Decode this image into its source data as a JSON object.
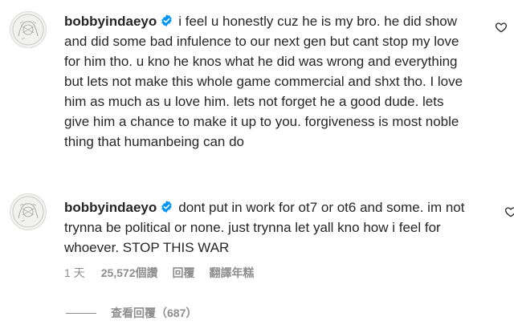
{
  "comments": [
    {
      "username": "bobbyindaeyo",
      "text": "i feel u honestly cuz he is my bro. he did show and did some bad infulence to our next gen but cant stop my love for him tho. u kno he knos what he did was wrong and everything but lets not make this whole game commercial and shxt tho. I love him as much as u love him. lets not forget he a good dude. lets give him a chance to make it up to you. forgiveness is most noble thing that humanbeing can do"
    },
    {
      "username": "bobbyindaeyo",
      "text": "dont put in work for ot7 or ot6 and some. im not trynna be political or none. just trynna let yall kno how i feel for whoever. STOP THIS WAR",
      "meta": {
        "time": "1 天",
        "likes": "25,572個讚",
        "reply": "回覆",
        "translate": "翻譯年糕"
      },
      "view_replies": "查看回覆（687）"
    }
  ],
  "colors": {
    "text": "#262626",
    "secondary": "#8e8e8e",
    "verified": "#0095f6"
  }
}
